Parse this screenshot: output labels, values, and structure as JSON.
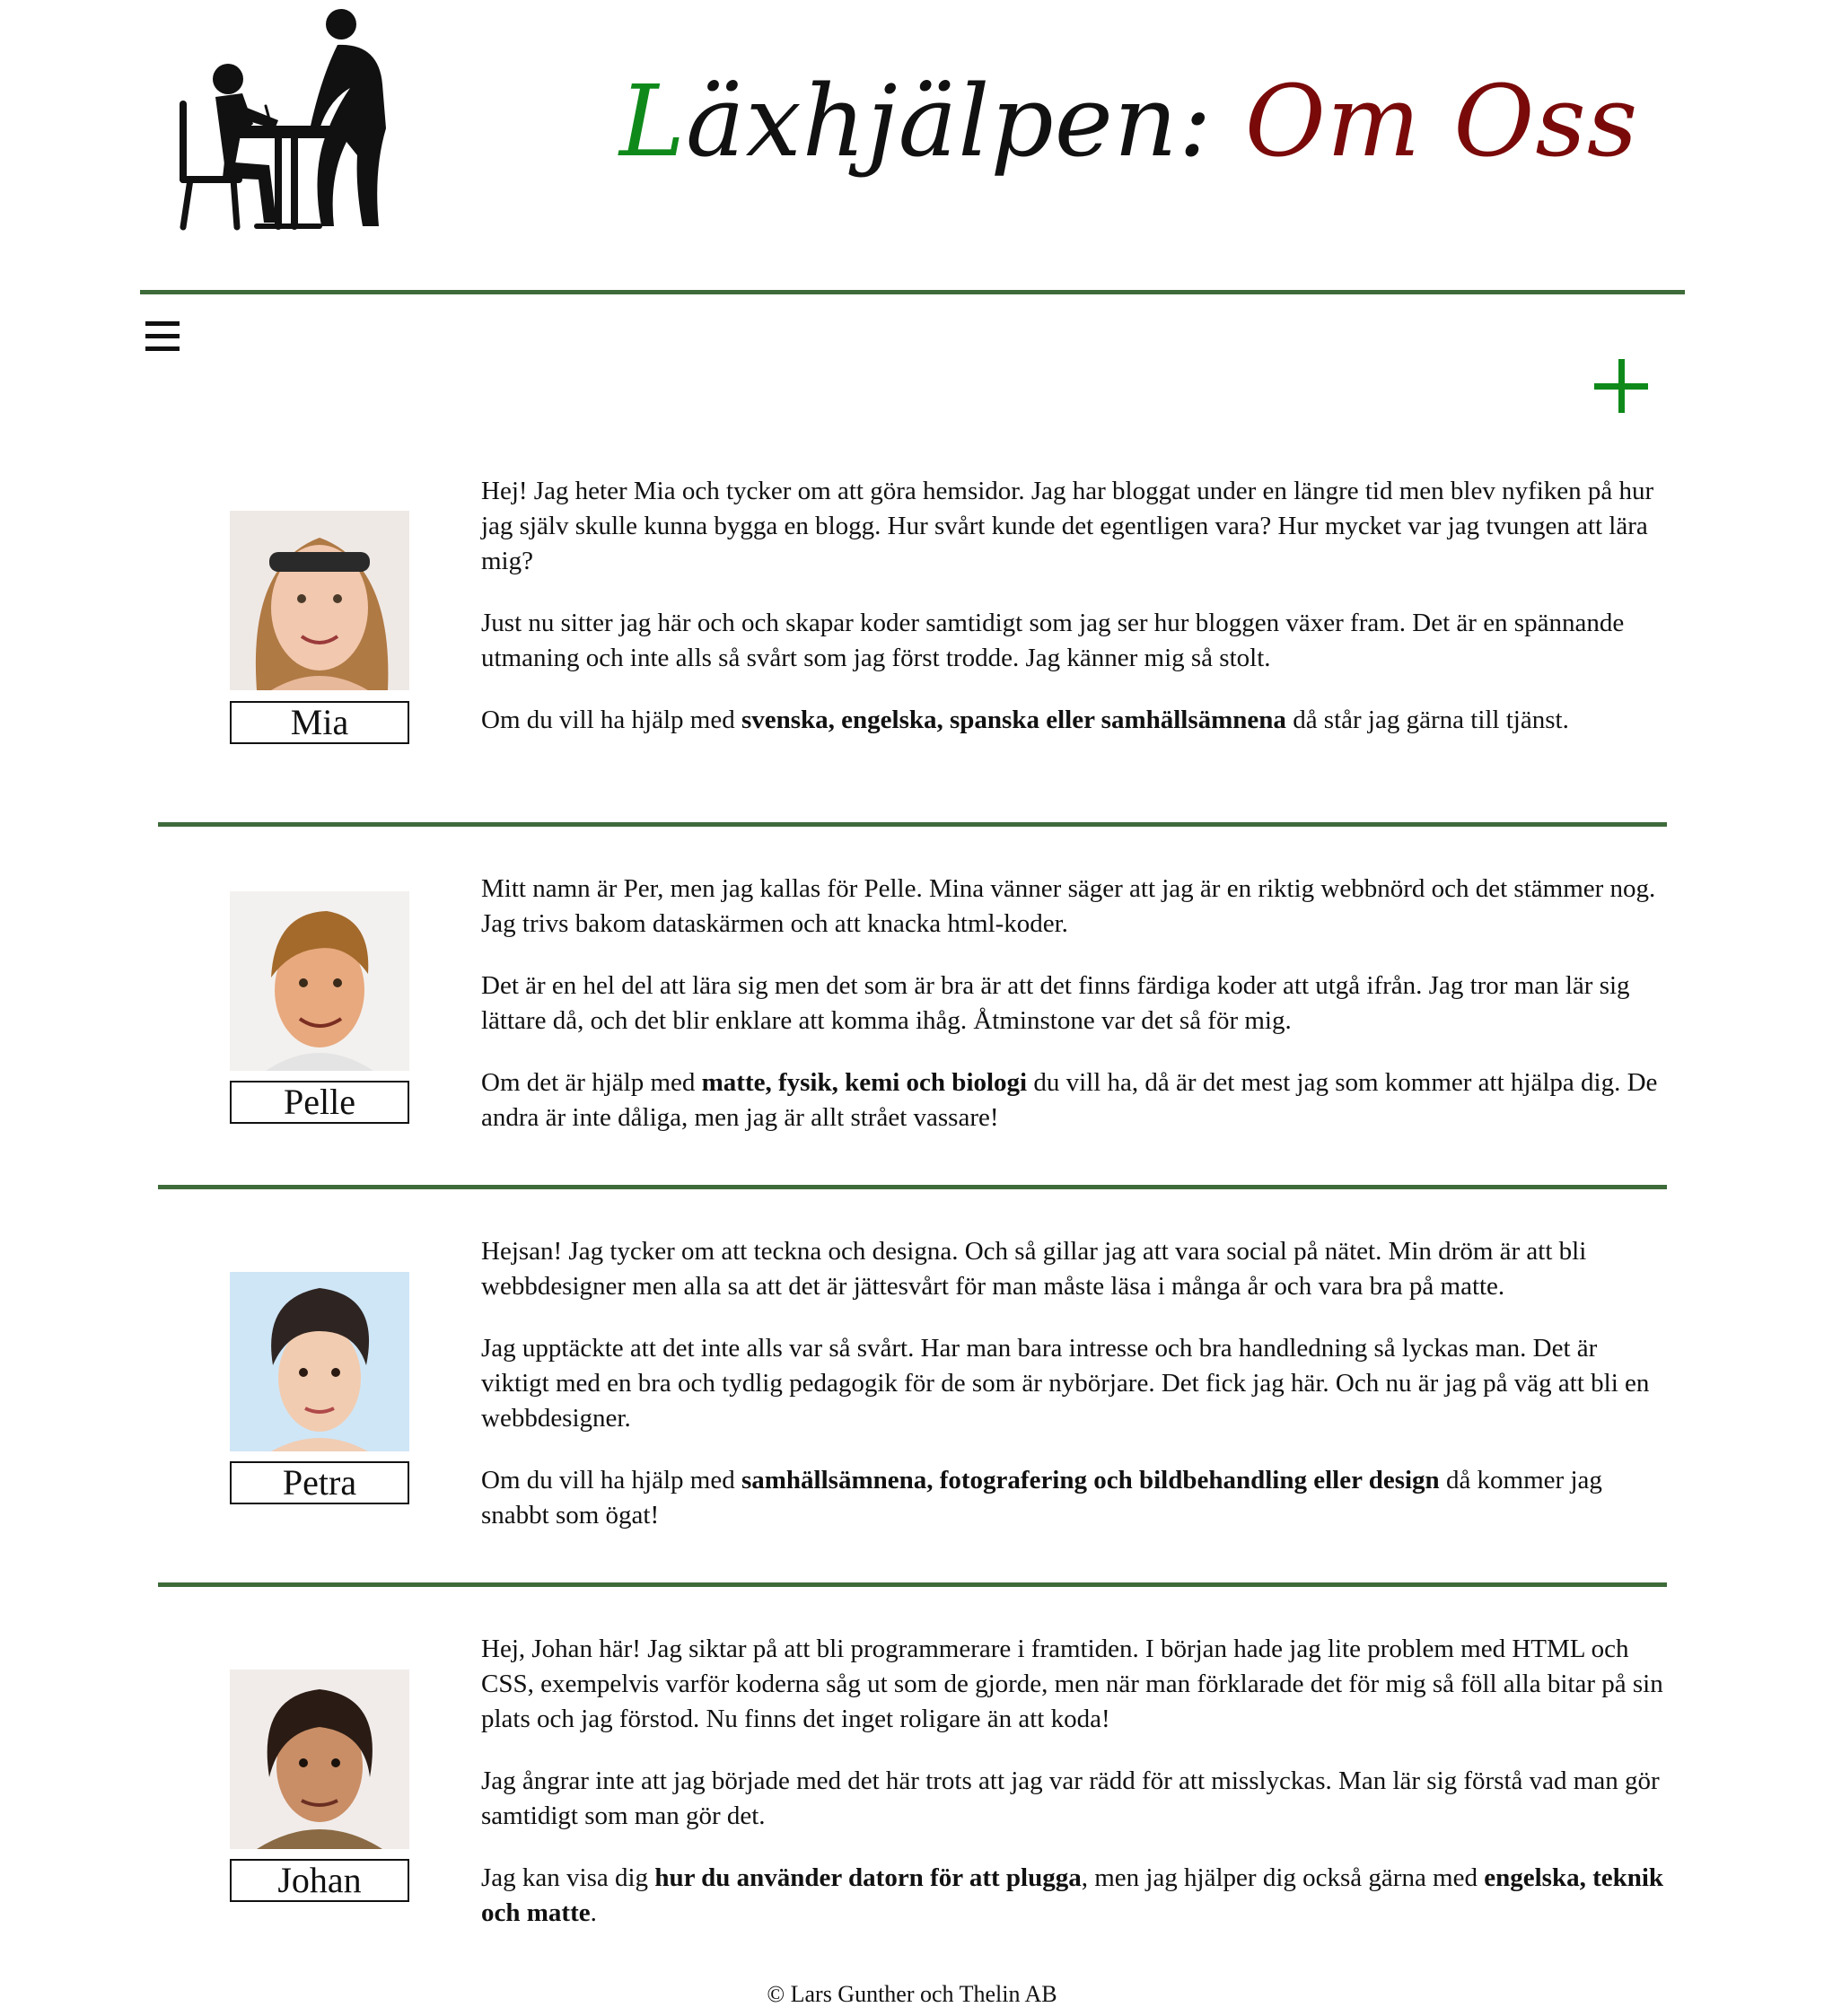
{
  "header": {
    "title_first_letter": "L",
    "title_rest": "äxhjälpen: ",
    "title_page": "Om Oss",
    "logo_icon": "student-with-teacher-icon",
    "menu_icon": "hamburger-menu-icon",
    "add_icon": "plus-icon"
  },
  "colors": {
    "accent_green": "#0f8a1a",
    "title_red": "#7a0a0a",
    "rule_green": "#3e6b3a"
  },
  "members": [
    {
      "name": "Mia",
      "paragraphs": [
        "Hej! Jag heter Mia och tycker om att göra hemsidor. Jag har bloggat under en längre tid men blev nyfiken på hur jag själv skulle kunna bygga en blogg. Hur svårt kunde det egentligen vara? Hur mycket var jag tvungen att lära mig?",
        "Just nu sitter jag här och och skapar koder samtidigt som jag ser hur bloggen växer fram. Det är en spännande utmaning och inte alls så svårt som jag först trodde. Jag känner mig så stolt."
      ],
      "help": {
        "pre": "Om du vill ha hjälp med ",
        "bold": "svenska, engelska, spanska eller samhällsämnena",
        "post": " då står jag gärna till tjänst."
      }
    },
    {
      "name": "Pelle",
      "paragraphs": [
        "Mitt namn är Per, men jag kallas för Pelle. Mina vänner säger att jag är en riktig webbnörd och det stämmer nog. Jag trivs bakom dataskärmen och att knacka html-koder.",
        "Det är en hel del att lära sig men det som är bra är att det finns färdiga koder att utgå ifrån. Jag tror man lär sig lättare då, och det blir enklare att komma ihåg. Åtminstone var det så för mig."
      ],
      "help": {
        "pre": "Om det är hjälp med ",
        "bold": "matte, fysik, kemi och biologi",
        "post": " du vill ha, då är det mest jag som kommer att hjälpa dig. De andra är inte dåliga, men jag är allt strået vassare!"
      }
    },
    {
      "name": "Petra",
      "paragraphs": [
        "Hejsan! Jag tycker om att teckna och designa. Och så gillar jag att vara social på nätet. Min dröm är att bli webbdesigner men alla sa att det är jättesvårt för man måste läsa i många år och vara bra på matte.",
        "Jag upptäckte att det inte alls var så svårt. Har man bara intresse och bra handledning så lyckas man. Det är viktigt med en bra och tydlig pedagogik för de som är nybörjare. Det fick jag här. Och nu är jag på väg att bli en webbdesigner."
      ],
      "help": {
        "pre": "Om du vill ha hjälp med ",
        "bold": "samhällsämnena, fotografering och bildbehandling eller design",
        "post": " då kommer jag snabbt som ögat!"
      }
    },
    {
      "name": "Johan",
      "paragraphs": [
        "Hej, Johan här! Jag siktar på att bli programmerare i framtiden. I början hade jag lite problem med HTML och CSS, exempelvis varför koderna såg ut som de gjorde, men när man förklarade det för mig så föll alla bitar på sin plats och jag förstod. Nu finns det inget roligare än att koda!",
        "Jag ångrar inte att jag började med det här trots att jag var rädd för att misslyckas. Man lär sig förstå vad man gör samtidigt som man gör det."
      ],
      "help": {
        "pre": "Jag kan visa dig ",
        "bold": "hur du använder datorn för att plugga",
        "mid": ", men jag hjälper dig också gärna med ",
        "bold2": "engelska, teknik och matte",
        "post": "."
      }
    }
  ],
  "footer": {
    "text": "© Lars Gunther och Thelin AB"
  }
}
